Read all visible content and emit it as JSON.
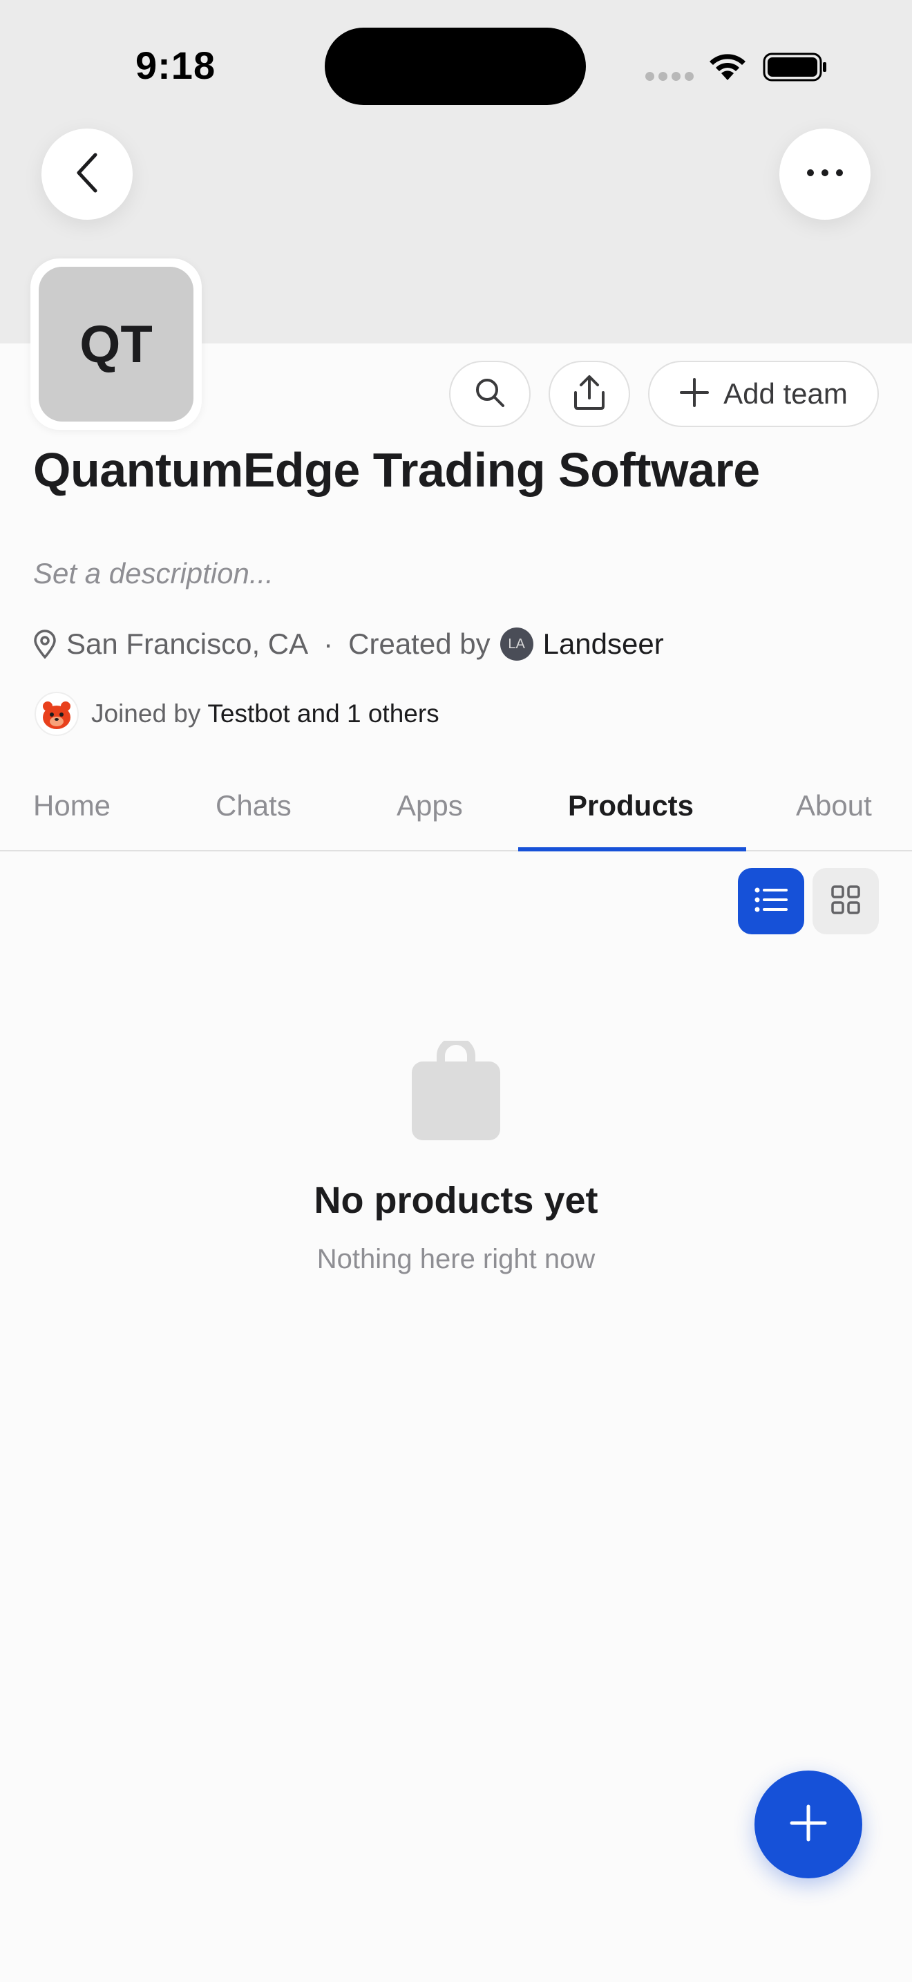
{
  "status_bar": {
    "time": "9:18"
  },
  "team": {
    "initials": "QT",
    "name": "QuantumEdge Trading Software",
    "description_placeholder": "Set a description...",
    "location": "San Francisco, CA",
    "separator": "·",
    "created_by_label": "Created by",
    "creator_initials": "LA",
    "creator_name": "Landseer",
    "joined_by_label": "Joined by",
    "joined_by_names": "Testbot and 1 others"
  },
  "actions": {
    "add_team_label": "Add team"
  },
  "tabs": [
    {
      "label": "Home",
      "active": false
    },
    {
      "label": "Chats",
      "active": false
    },
    {
      "label": "Apps",
      "active": false
    },
    {
      "label": "Products",
      "active": true
    },
    {
      "label": "About",
      "active": false
    }
  ],
  "view_mode": "list",
  "empty_state": {
    "icon": "shopping-bag-icon",
    "title": "No products yet",
    "subtitle": "Nothing here right now"
  },
  "colors": {
    "accent": "#1651d8",
    "header_bg": "#ebebeb",
    "page_bg": "#fbfbfb"
  }
}
